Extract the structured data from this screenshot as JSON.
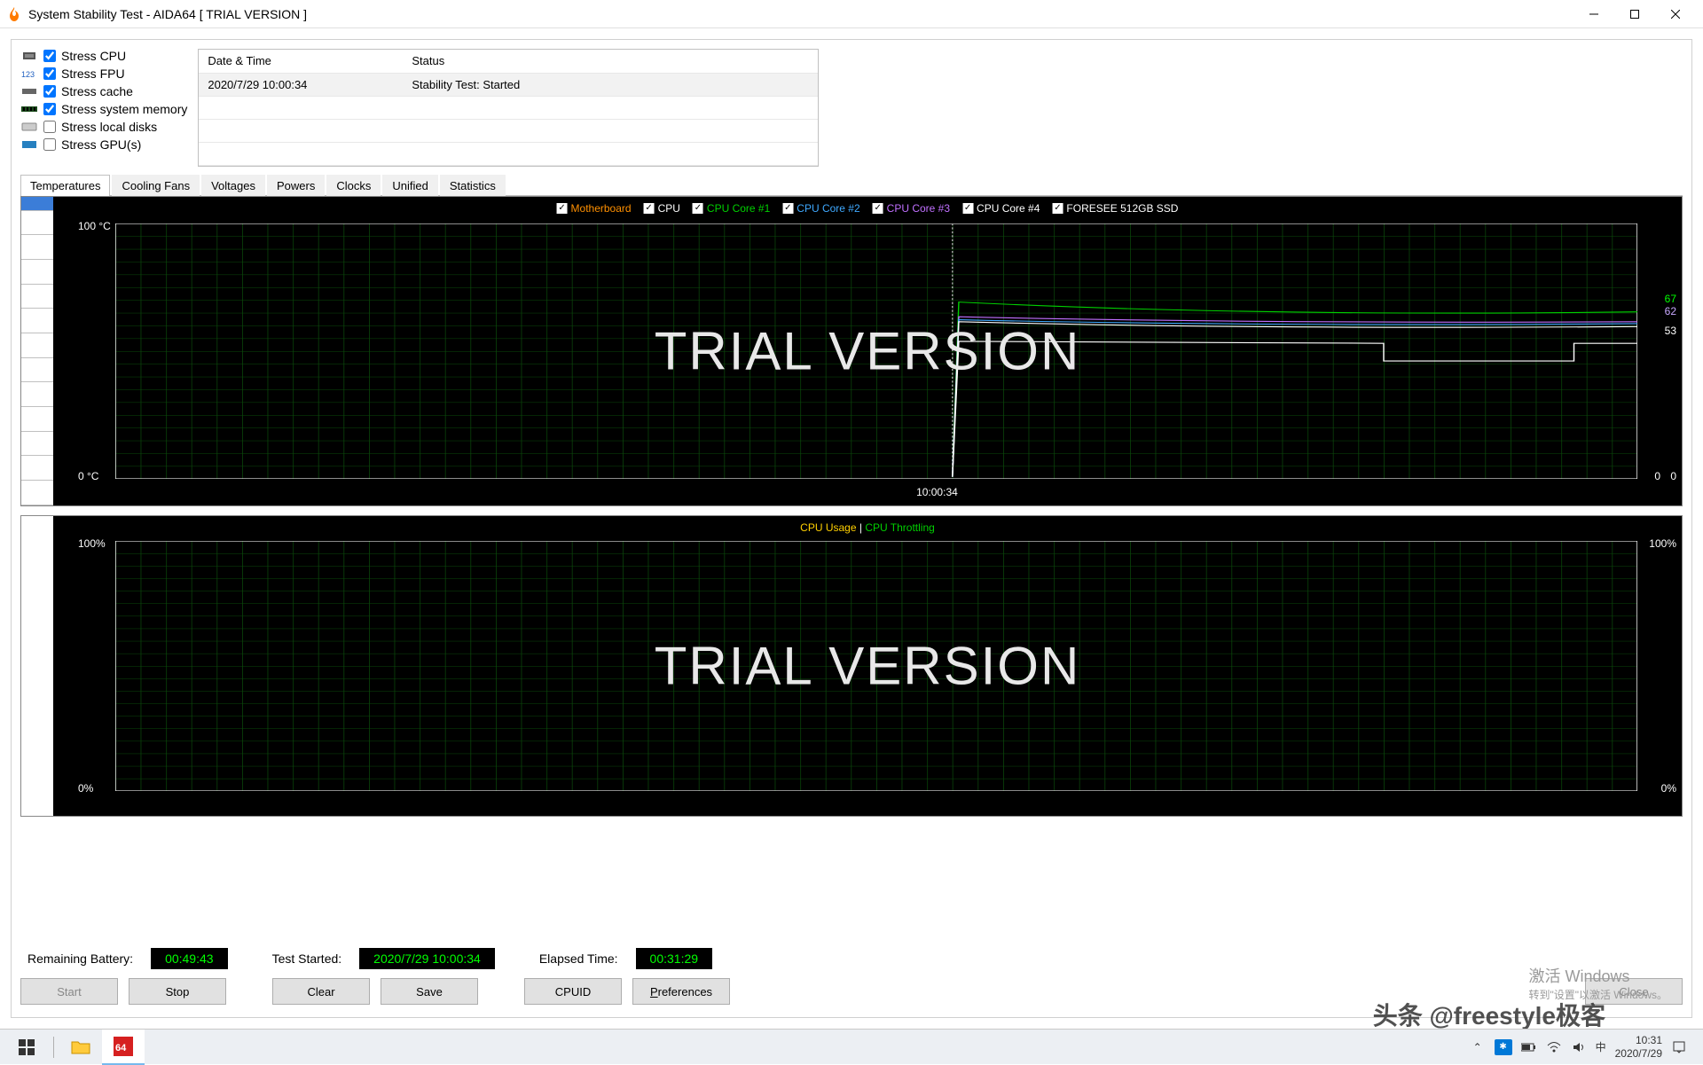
{
  "window": {
    "title": "System Stability Test - AIDA64  [ TRIAL VERSION ]"
  },
  "stress": {
    "cpu": {
      "label": "Stress CPU",
      "checked": true
    },
    "fpu": {
      "label": "Stress FPU",
      "checked": true
    },
    "cache": {
      "label": "Stress cache",
      "checked": true
    },
    "mem": {
      "label": "Stress system memory",
      "checked": true
    },
    "disk": {
      "label": "Stress local disks",
      "checked": false
    },
    "gpu": {
      "label": "Stress GPU(s)",
      "checked": false
    }
  },
  "log": {
    "col_datetime": "Date & Time",
    "col_status": "Status",
    "rows": [
      {
        "datetime": "2020/7/29 10:00:34",
        "status": "Stability Test: Started"
      }
    ]
  },
  "tabs": {
    "temperatures": "Temperatures",
    "cooling": "Cooling Fans",
    "voltages": "Voltages",
    "powers": "Powers",
    "clocks": "Clocks",
    "unified": "Unified",
    "statistics": "Statistics",
    "active": "temperatures"
  },
  "graph1": {
    "legend": {
      "mb": {
        "label": "Motherboard",
        "color": "#ff9000"
      },
      "cpu": {
        "label": "CPU",
        "color": "#ffffff"
      },
      "c1": {
        "label": "CPU Core #1",
        "color": "#00d000"
      },
      "c2": {
        "label": "CPU Core #2",
        "color": "#3fa9ff"
      },
      "c3": {
        "label": "CPU Core #3",
        "color": "#c070ff"
      },
      "c4": {
        "label": "CPU Core #4",
        "color": "#ffffff"
      },
      "ssd": {
        "label": "FORESEE 512GB SSD",
        "color": "#ffffff"
      }
    },
    "y_max": "100 °C",
    "y_min": "0 °C",
    "x_marker": "10:00:34",
    "right_values": {
      "v1": "67",
      "v2": "62",
      "v3": "53",
      "v4": "0",
      "v5": "0"
    },
    "watermark": "TRIAL VERSION"
  },
  "graph2": {
    "usage_label": "CPU Usage",
    "sep": "|",
    "throttle_label": "CPU Throttling",
    "y_max_l": "100%",
    "y_min_l": "0%",
    "y_max_r": "100%",
    "y_min_r": "0%",
    "watermark": "TRIAL VERSION"
  },
  "status": {
    "battery_label": "Remaining Battery:",
    "battery_value": "00:49:43",
    "started_label": "Test Started:",
    "started_value": "2020/7/29 10:00:34",
    "elapsed_label": "Elapsed Time:",
    "elapsed_value": "00:31:29"
  },
  "buttons": {
    "start": "Start",
    "stop": "Stop",
    "clear": "Clear",
    "save": "Save",
    "cpuid": "CPUID",
    "prefs": "Preferences",
    "close": "Close"
  },
  "activate": {
    "line1": "激活 Windows",
    "line2": "转到\"设置\"以激活 Windows。"
  },
  "overlay": "头条 @freestyle极客",
  "taskbar": {
    "ime": "中",
    "time": "10:31",
    "date": "2020/7/29"
  },
  "chart_data": [
    {
      "type": "line",
      "title": "Temperatures",
      "ylabel": "°C",
      "ylim": [
        0,
        100
      ],
      "x_event_marker": "10:00:34",
      "series": [
        {
          "name": "Motherboard",
          "approx_steady": 53
        },
        {
          "name": "CPU",
          "approx_steady": 62
        },
        {
          "name": "CPU Core #1",
          "approx_steady": 67
        },
        {
          "name": "CPU Core #2",
          "approx_steady": 65
        },
        {
          "name": "CPU Core #3",
          "approx_steady": 65
        },
        {
          "name": "CPU Core #4",
          "approx_steady": 65
        },
        {
          "name": "FORESEE 512GB SSD",
          "approx_steady": 53
        }
      ],
      "note": "Lines are near 0 before 10:00:34, then rise to steady band ~53–67°C"
    },
    {
      "type": "line",
      "title": "CPU Usage / Throttling",
      "ylabel": "%",
      "ylim": [
        0,
        100
      ],
      "series": [
        {
          "name": "CPU Usage",
          "values": []
        },
        {
          "name": "CPU Throttling",
          "values": []
        }
      ],
      "note": "No visible data lines rendered (trial watermark only)"
    }
  ]
}
